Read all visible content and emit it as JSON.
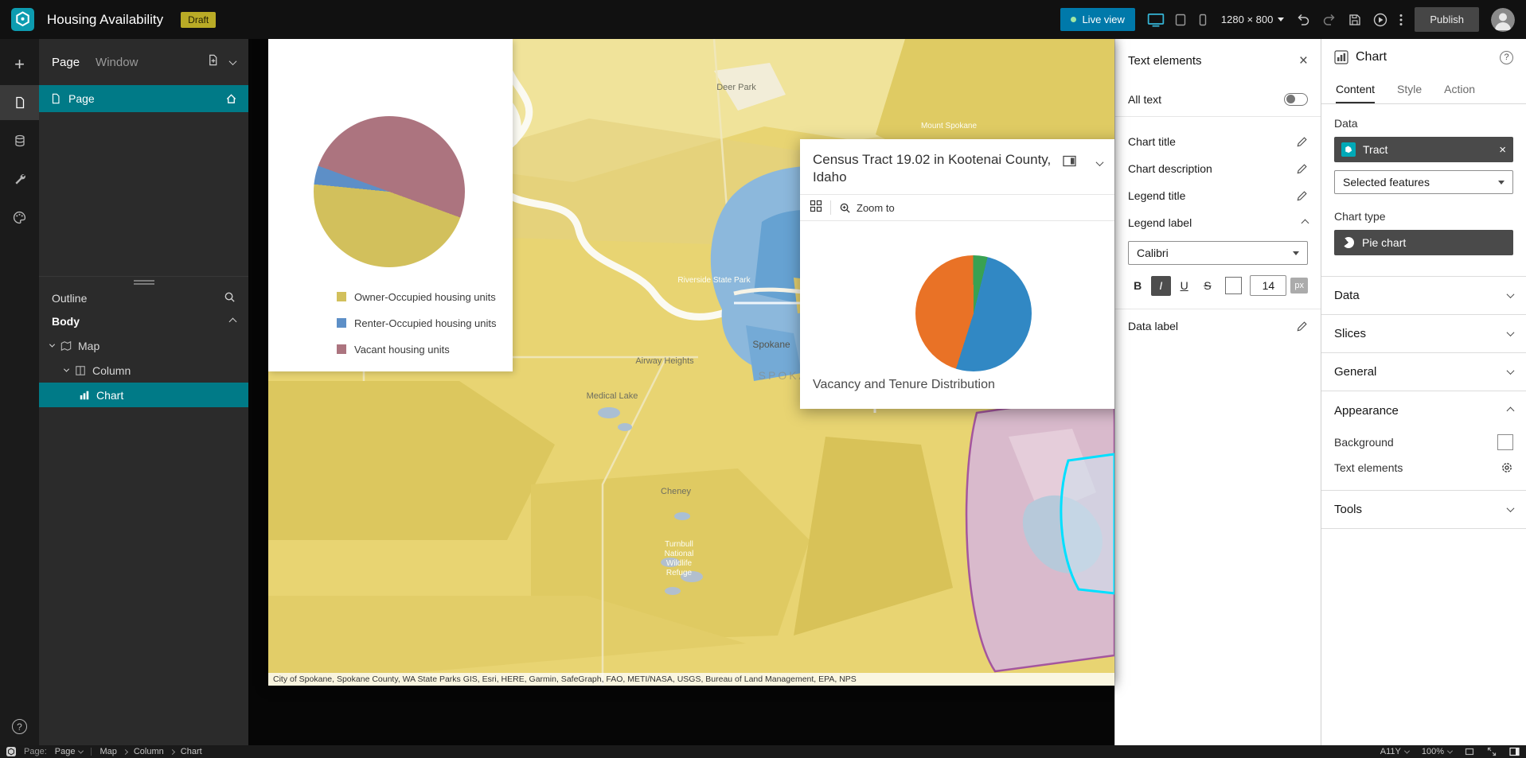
{
  "topbar": {
    "title": "Housing Availability",
    "status_badge": "Draft",
    "live_view_label": "Live view",
    "resolution_label": "1280 × 800",
    "publish_label": "Publish"
  },
  "left_panel": {
    "tab_page": "Page",
    "tab_window": "Window",
    "page_item_label": "Page",
    "outline_title": "Outline",
    "body_label": "Body",
    "tree_map": "Map",
    "tree_column": "Column",
    "tree_chart": "Chart"
  },
  "map": {
    "labels": [
      "Deer Park",
      "Mount Spokane",
      "Riverside State Park",
      "Airway Heights",
      "Spokane",
      "SPOKANE",
      "Medical Lake",
      "Cheney",
      "Turnbull",
      "National",
      "Wildlife",
      "Refuge"
    ],
    "attribution": "City of Spokane, Spokane County, WA State Parks GIS, Esri, HERE, Garmin, SafeGraph, FAO, METI/NASA, USGS, Bureau of Land Management, EPA, NPS"
  },
  "popup": {
    "title": "Census Tract 19.02 in Kootenai County, Idaho",
    "zoom_to_label": "Zoom to",
    "caption": "Vacancy and Tenure Distribution"
  },
  "text_panel": {
    "title": "Text elements",
    "all_text_label": "All text",
    "row_chart_title": "Chart title",
    "row_chart_description": "Chart description",
    "row_legend_title": "Legend title",
    "row_legend_label": "Legend label",
    "font_family": "Calibri",
    "bold": "B",
    "italic": "I",
    "underline": "U",
    "strikethrough": "S",
    "font_size": "14",
    "unit": "px",
    "row_data_label": "Data label"
  },
  "chart_panel": {
    "title": "Chart",
    "help": "?",
    "tab_content": "Content",
    "tab_style": "Style",
    "tab_action": "Action",
    "data_label": "Data",
    "data_source": "Tract",
    "features_select": "Selected features",
    "chart_type_label": "Chart type",
    "chart_type_value": "Pie chart",
    "section_data": "Data",
    "section_slices": "Slices",
    "section_general": "General",
    "section_appearance": "Appearance",
    "appearance_background": "Background",
    "appearance_text_elements": "Text elements",
    "section_tools": "Tools"
  },
  "statusbar": {
    "page_label": "Page:",
    "page_value": "Page",
    "crumb_map": "Map",
    "crumb_column": "Column",
    "crumb_chart": "Chart",
    "a11y": "A11Y",
    "zoom": "100%"
  },
  "accent_colors": {
    "selection_teal": "#007a87",
    "live_view_blue": "#0079aa",
    "widget_badge_blue": "#2d7ae0",
    "tract_highlight_cyan": "#00e0ff"
  },
  "chart_data": [
    {
      "type": "pie",
      "from_deg": 110,
      "slices": [
        {
          "label": "Owner-Occupied housing units",
          "color": "#d2c05c",
          "pct": 46
        },
        {
          "label": "Renter-Occupied housing units",
          "color": "#5d8fc7",
          "pct": 4
        },
        {
          "label": "Vacant housing units",
          "color": "#ac747f",
          "pct": 50
        }
      ]
    },
    {
      "type": "pie",
      "title": "Vacancy and Tenure Distribution",
      "from_deg": 14,
      "slices": [
        {
          "color": "#3188c4",
          "pct": 51
        },
        {
          "color": "#e97226",
          "pct": 45
        },
        {
          "color": "#39a152",
          "pct": 4
        }
      ]
    }
  ]
}
